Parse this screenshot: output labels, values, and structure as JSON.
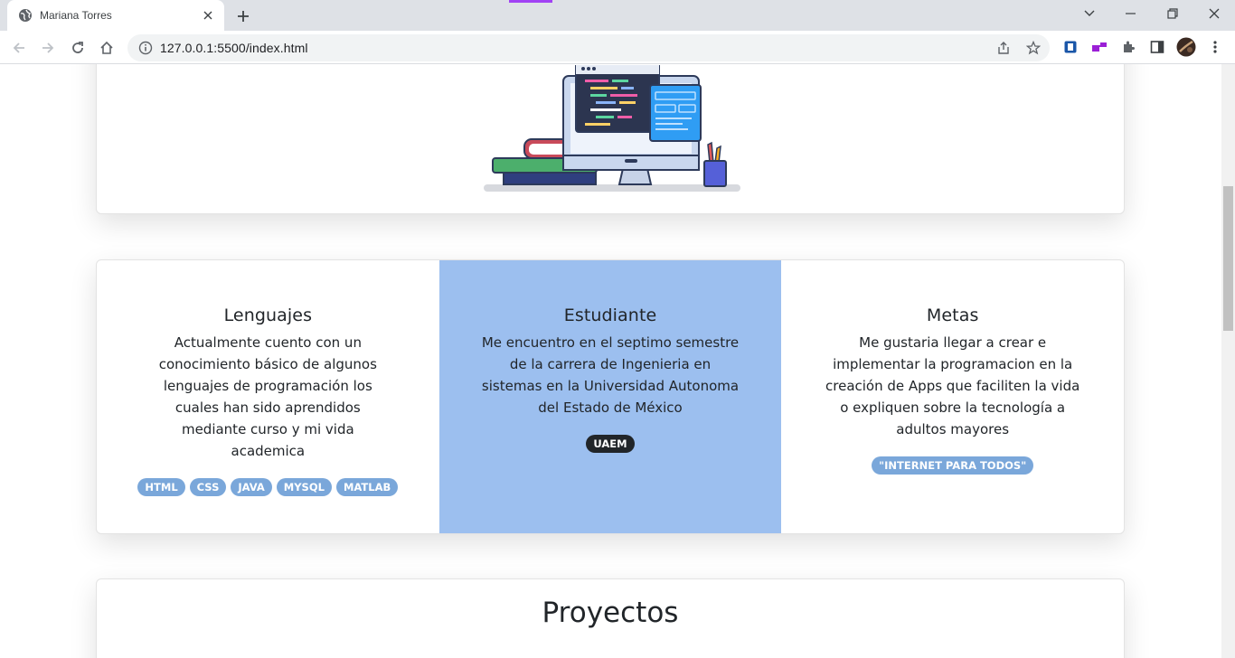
{
  "browser": {
    "tab_title": "Mariana Torres",
    "url": "127.0.0.1:5500/index.html"
  },
  "colors": {
    "accent_blue": "#9cbfef",
    "badge_blue": "#7aa7da",
    "badge_dark": "#212529",
    "profile_strip": "#a142f4"
  },
  "icons": [
    "globe-icon",
    "close-icon",
    "plus-icon",
    "chevron-down-icon",
    "minimize-icon",
    "restore-icon",
    "back-arrow-icon",
    "forward-arrow-icon",
    "reload-icon",
    "home-icon",
    "info-icon",
    "share-icon",
    "star-icon",
    "extension-icon",
    "side-panel-icon",
    "more-vert-icon"
  ],
  "hero": {
    "image": "computer-illustration"
  },
  "cards": [
    {
      "title": "Lenguajes",
      "text": "Actualmente cuento con un conocimiento básico de algunos lenguajes de programación los cuales han sido aprendidos mediante curso y mi vida academica",
      "badges": [
        "HTML",
        "CSS",
        "JAVA",
        "MYSQL",
        "MATLAB"
      ]
    },
    {
      "title": "Estudiante",
      "text": "Me encuentro en el septimo semestre de la carrera de Ingenieria en sistemas en la Universidad Autonoma del Estado de México",
      "badges": [
        "UAEM"
      ]
    },
    {
      "title": "Metas",
      "text": "Me gustaria llegar a crear e implementar la programacion en la creación de Apps que faciliten la vida o expliquen sobre la tecnología a adultos mayores",
      "badges": [
        "\"INTERNET PARA TODOS\""
      ]
    }
  ],
  "projects": {
    "title": "Proyectos"
  }
}
